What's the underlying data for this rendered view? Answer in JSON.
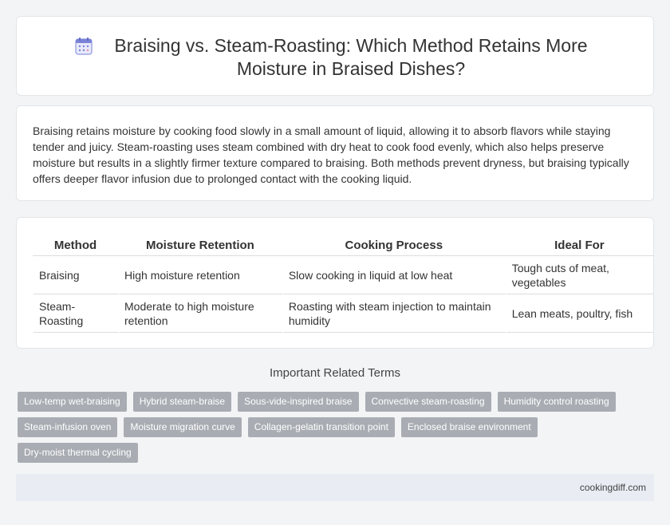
{
  "header": {
    "title": "Braising vs. Steam-Roasting: Which Method Retains More Moisture in Braised Dishes?",
    "icon": "calendar-icon"
  },
  "summary": "Braising retains moisture by cooking food slowly in a small amount of liquid, allowing it to absorb flavors while staying tender and juicy. Steam-roasting uses steam combined with dry heat to cook food evenly, which also helps preserve moisture but results in a slightly firmer texture compared to braising. Both methods prevent dryness, but braising typically offers deeper flavor infusion due to prolonged contact with the cooking liquid.",
  "table": {
    "headers": [
      "Method",
      "Moisture Retention",
      "Cooking Process",
      "Ideal For"
    ],
    "rows": [
      [
        "Braising",
        "High moisture retention",
        "Slow cooking in liquid at low heat",
        "Tough cuts of meat, vegetables"
      ],
      [
        "Steam-Roasting",
        "Moderate to high moisture retention",
        "Roasting with steam injection to maintain humidity",
        "Lean meats, poultry, fish"
      ]
    ]
  },
  "related": {
    "title": "Important Related Terms",
    "tags": [
      "Low-temp wet-braising",
      "Hybrid steam-braise",
      "Sous-vide-inspired braise",
      "Convective steam-roasting",
      "Humidity control roasting",
      "Steam-infusion oven",
      "Moisture migration curve",
      "Collagen-gelatin transition point",
      "Enclosed braise environment",
      "Dry-moist thermal cycling"
    ]
  },
  "footer": {
    "site": "cookingdiff.com"
  },
  "colors": {
    "tag_bg": "#a9adb3",
    "footer_bg": "#e9ecf3",
    "icon_accent": "#7b83d6"
  }
}
